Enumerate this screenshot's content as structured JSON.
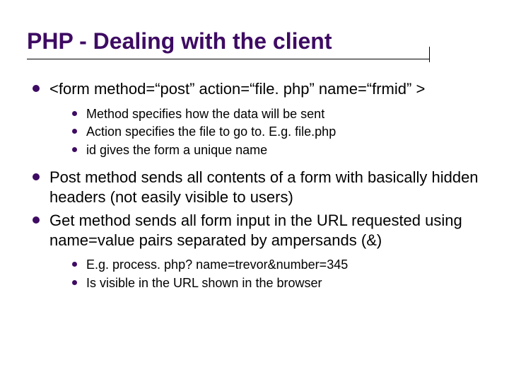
{
  "slide": {
    "title": "PHP - Dealing with the client",
    "bullets": [
      {
        "text": "<form method=“post” action=“file. php” name=“frmid” >",
        "sub": [
          "Method specifies how the data will be sent",
          "Action specifies the file to go to. E.g. file.php",
          "id gives the form a unique name"
        ]
      },
      {
        "text": "Post method sends all contents of a form with basically hidden headers (not easily visible to users)",
        "sub": []
      },
      {
        "text": "Get method sends all form input in the URL requested using name=value pairs separated by ampersands (&)",
        "sub": [
          "E.g. process. php? name=trevor&number=345",
          "Is visible in the URL shown in the browser"
        ]
      }
    ]
  },
  "colors": {
    "accent": "#3e0b63"
  }
}
